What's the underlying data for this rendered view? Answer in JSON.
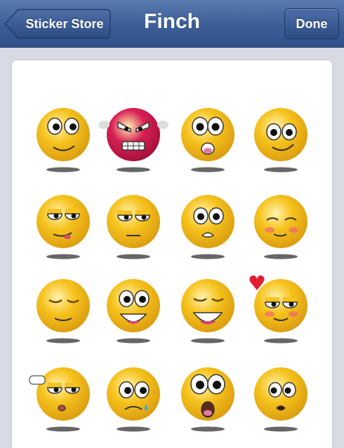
{
  "navbar": {
    "back_label": "Sticker Store",
    "title": "Finch",
    "done_label": "Done"
  },
  "colors": {
    "nav_top": "#5a7bb0",
    "nav_bottom": "#2f5089",
    "face_yellow": "#f6c21c",
    "face_angry": "#d81f55"
  },
  "stickers": [
    {
      "name": "sticker-content"
    },
    {
      "name": "sticker-angry"
    },
    {
      "name": "sticker-surprised"
    },
    {
      "name": "sticker-smile"
    },
    {
      "name": "sticker-flirty"
    },
    {
      "name": "sticker-unimpressed"
    },
    {
      "name": "sticker-worried"
    },
    {
      "name": "sticker-blushing"
    },
    {
      "name": "sticker-relaxed"
    },
    {
      "name": "sticker-happy"
    },
    {
      "name": "sticker-laughing"
    },
    {
      "name": "sticker-in-love"
    },
    {
      "name": "sticker-pointing"
    },
    {
      "name": "sticker-sad"
    },
    {
      "name": "sticker-shocked"
    },
    {
      "name": "sticker-shy"
    }
  ]
}
